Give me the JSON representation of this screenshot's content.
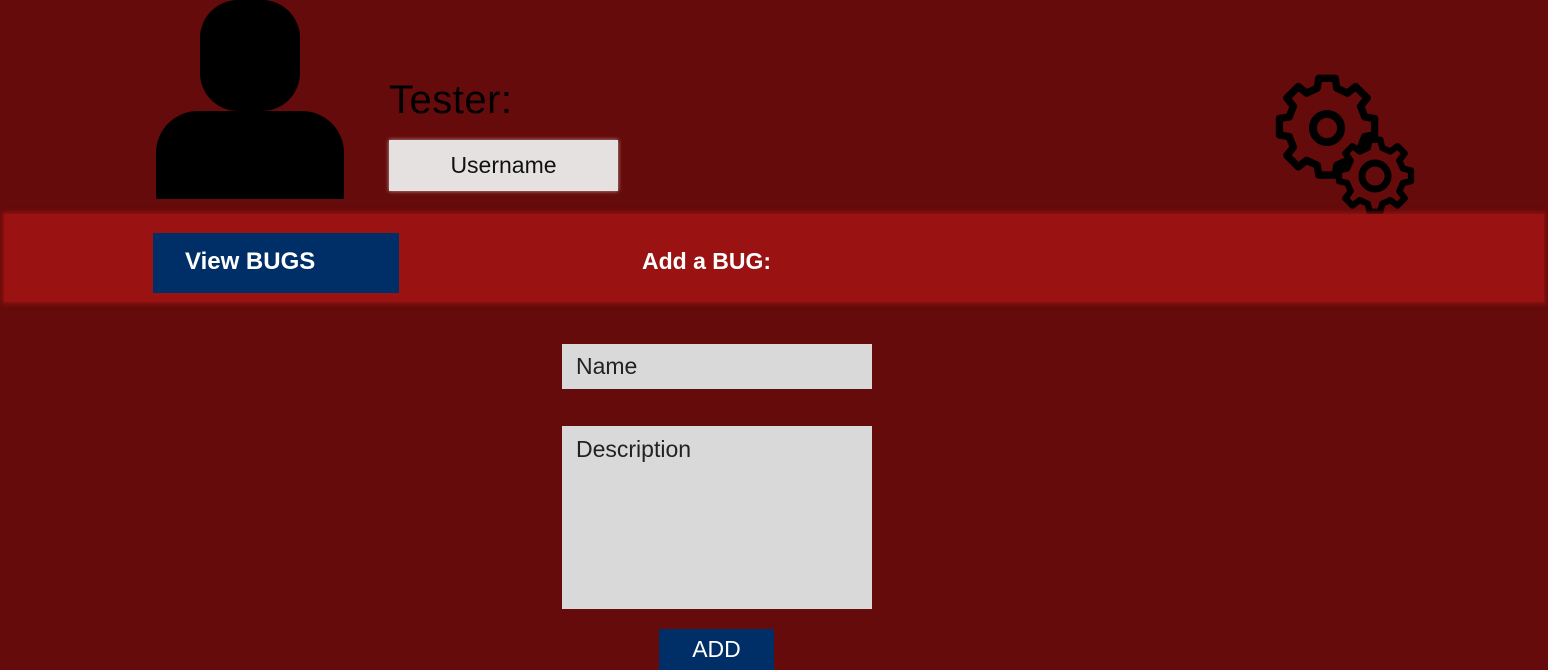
{
  "header": {
    "role_label": "Tester:",
    "username": "Username"
  },
  "nav": {
    "view_bugs_label": "View BUGS",
    "add_bug_title": "Add a BUG:"
  },
  "form": {
    "name_placeholder": "Name",
    "description_placeholder": "Description",
    "add_label": "ADD"
  },
  "icons": {
    "avatar": "user-avatar-icon",
    "settings": "gears-icon"
  },
  "colors": {
    "background": "#650b0b",
    "nav_bar": "#9b1213",
    "button": "#002e66",
    "field": "#d9d9d9"
  }
}
